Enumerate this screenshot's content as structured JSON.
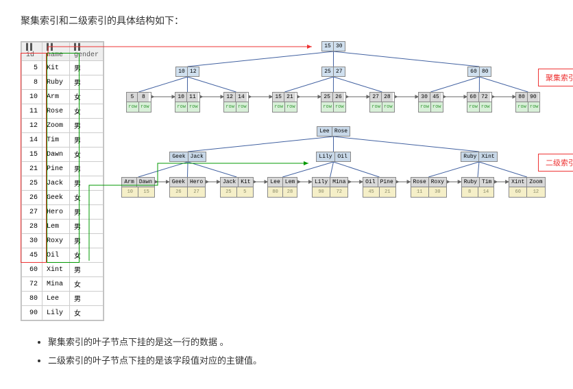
{
  "title": "聚集索引和二级索引的具体结构如下：",
  "table": {
    "headers": [
      "id",
      "name",
      "gender"
    ],
    "rows": [
      {
        "id": 5,
        "name": "Kit",
        "gender": "男"
      },
      {
        "id": 8,
        "name": "Ruby",
        "gender": "男"
      },
      {
        "id": 10,
        "name": "Arm",
        "gender": "女"
      },
      {
        "id": 11,
        "name": "Rose",
        "gender": "女"
      },
      {
        "id": 12,
        "name": "Zoom",
        "gender": "男"
      },
      {
        "id": 14,
        "name": "Tim",
        "gender": "男"
      },
      {
        "id": 15,
        "name": "Dawn",
        "gender": "女"
      },
      {
        "id": 21,
        "name": "Pine",
        "gender": "男"
      },
      {
        "id": 25,
        "name": "Jack",
        "gender": "男"
      },
      {
        "id": 26,
        "name": "Geek",
        "gender": "女"
      },
      {
        "id": 27,
        "name": "Hero",
        "gender": "男"
      },
      {
        "id": 28,
        "name": "Lem",
        "gender": "男"
      },
      {
        "id": 30,
        "name": "Roxy",
        "gender": "男"
      },
      {
        "id": 45,
        "name": "Oil",
        "gender": "女"
      },
      {
        "id": 60,
        "name": "Xint",
        "gender": "男"
      },
      {
        "id": 72,
        "name": "Mina",
        "gender": "女"
      },
      {
        "id": 80,
        "name": "Lee",
        "gender": "男"
      },
      {
        "id": 90,
        "name": "Lily",
        "gender": "女"
      }
    ]
  },
  "clustered": {
    "label": "聚集索引",
    "root": [
      15,
      30
    ],
    "mids": [
      [
        10,
        12
      ],
      [
        25,
        27
      ],
      [
        60,
        80
      ]
    ],
    "leaves": [
      {
        "k": [
          5,
          8
        ],
        "d": [
          "row",
          "row"
        ]
      },
      {
        "k": [
          10,
          11
        ],
        "d": [
          "row",
          "row"
        ]
      },
      {
        "k": [
          12,
          14
        ],
        "d": [
          "row",
          "row"
        ]
      },
      {
        "k": [
          15,
          21
        ],
        "d": [
          "row",
          "row"
        ]
      },
      {
        "k": [
          25,
          26
        ],
        "d": [
          "row",
          "row"
        ]
      },
      {
        "k": [
          27,
          28
        ],
        "d": [
          "row",
          "row"
        ]
      },
      {
        "k": [
          30,
          45
        ],
        "d": [
          "row",
          "row"
        ]
      },
      {
        "k": [
          60,
          72
        ],
        "d": [
          "row",
          "row"
        ]
      },
      {
        "k": [
          80,
          90
        ],
        "d": [
          "row",
          "row"
        ]
      }
    ]
  },
  "secondary": {
    "label": "二级索引",
    "root": [
      "Lee",
      "Rose"
    ],
    "mids": [
      [
        "Geek",
        "Jack"
      ],
      [
        "Lily",
        "Oil"
      ],
      [
        "Ruby",
        "Xint"
      ]
    ],
    "leaves": [
      {
        "k": [
          "Arm",
          "Dawn"
        ],
        "d": [
          10,
          15
        ]
      },
      {
        "k": [
          "Geek",
          "Hero"
        ],
        "d": [
          26,
          27
        ]
      },
      {
        "k": [
          "Jack",
          "Kit"
        ],
        "d": [
          25,
          5
        ]
      },
      {
        "k": [
          "Lee",
          "Lem"
        ],
        "d": [
          80,
          28
        ]
      },
      {
        "k": [
          "Lily",
          "Mina"
        ],
        "d": [
          90,
          72
        ]
      },
      {
        "k": [
          "Oil",
          "Pine"
        ],
        "d": [
          45,
          21
        ]
      },
      {
        "k": [
          "Rose",
          "Roxy"
        ],
        "d": [
          11,
          30
        ]
      },
      {
        "k": [
          "Ruby",
          "Tim"
        ],
        "d": [
          8,
          14
        ]
      },
      {
        "k": [
          "Xint",
          "Zoom"
        ],
        "d": [
          60,
          12
        ]
      }
    ]
  },
  "bullets": [
    "聚集索引的叶子节点下挂的是这一行的数据 。",
    "二级索引的叶子节点下挂的是该字段值对应的主键值。"
  ]
}
